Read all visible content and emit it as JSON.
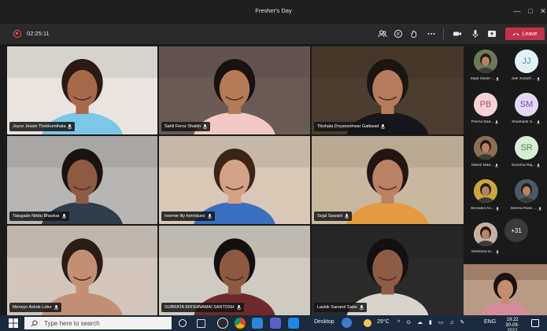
{
  "window": {
    "title": "Fresher's Day"
  },
  "meeting": {
    "timer": "02:25:11",
    "leave_label": "Leave",
    "leave_color": "#c4314b",
    "record_color": "#f25f5c"
  },
  "toolbar_icons": [
    "participants-icon",
    "chat-icon",
    "reactions-icon",
    "more-options-icon",
    "camera-icon",
    "microphone-icon",
    "share-screen-icon"
  ],
  "grid": [
    {
      "name": "Joyce Jessin Thekkumthala",
      "bg": "#e9e4df",
      "skin": "#a66a4a",
      "hair": "#2b1a14",
      "shirt": "#7cc7e8"
    },
    {
      "name": "Sahil Feroz Shaikh",
      "bg": "#6b5b57",
      "skin": "#b57a57",
      "hair": "#1a1210",
      "shirt": "#f2c9c4"
    },
    {
      "name": "Tikshala Dnyaneshwar Gaikwad",
      "bg": "#4b3d2f",
      "skin": "#b57c5c",
      "hair": "#1d1512",
      "shirt": "#17161c"
    },
    {
      "name": "Tatugade Nikita Bhaskar",
      "bg": "#b8b6b5",
      "skin": "#8e5b42",
      "hair": "#1a1311",
      "shirt": "#2f3e4a"
    },
    {
      "name": "noemie lily henriques",
      "bg": "#d7c8b7",
      "skin": "#d3a184",
      "hair": "#3a2417",
      "shirt": "#3a6fbf"
    },
    {
      "name": "Sejal Sawant",
      "bg": "#c8b8a0",
      "skin": "#b98363",
      "hair": "#231612",
      "shirt": "#e49a3f"
    },
    {
      "name": "Merwyn Ashok Lobo",
      "bg": "#d2c6bc",
      "skin": "#c38f74",
      "hair": "#2a1c16",
      "shirt": "#c38f74"
    },
    {
      "name": "SUBRATA KRISHNAMAI SANTOSH",
      "bg": "#cfcac2",
      "skin": "#8d5a41",
      "hair": "#151010",
      "shirt": "#6e2a2a"
    },
    {
      "name": "Laukik Sanand Sabe",
      "bg": "#2a2a2a",
      "skin": "#8c5c44",
      "hair": "#121010",
      "shirt": "#d8d3cb"
    }
  ],
  "roster": [
    {
      "name": "Sejal Xavier ...",
      "initials": "",
      "color": "#6b7a5a"
    },
    {
      "name": "Joel Joseph ...",
      "initials": "JJ",
      "color": "#e3f1f5",
      "text": "#4d8fa3"
    },
    {
      "name": "Prerna Dad...",
      "initials": "PB",
      "color": "#f6d3d8",
      "text": "#b14e63"
    },
    {
      "name": "Shashank S...",
      "initials": "SM",
      "color": "#e3d9f1",
      "text": "#6c50a6"
    },
    {
      "name": "Nilesh Mad...",
      "initials": "",
      "color": "#8a6f52"
    },
    {
      "name": "Suvarna Raj...",
      "initials": "SR",
      "color": "#d6eed5",
      "text": "#4e8c4a"
    },
    {
      "name": "Benedict An...",
      "initials": "",
      "color": "#c9a73b"
    },
    {
      "name": "Seema Rose ...",
      "initials": "",
      "color": "#4a5a6a"
    },
    {
      "name": "Selestina to...",
      "initials": "",
      "color": "#c6b0a4"
    }
  ],
  "roster_more": "+31",
  "taskbar": {
    "search_placeholder": "Type here to search",
    "desktop_label": "Desktop",
    "temperature": "29°C",
    "language": "ENG",
    "time": "19:22",
    "date": "30-09-2021"
  }
}
